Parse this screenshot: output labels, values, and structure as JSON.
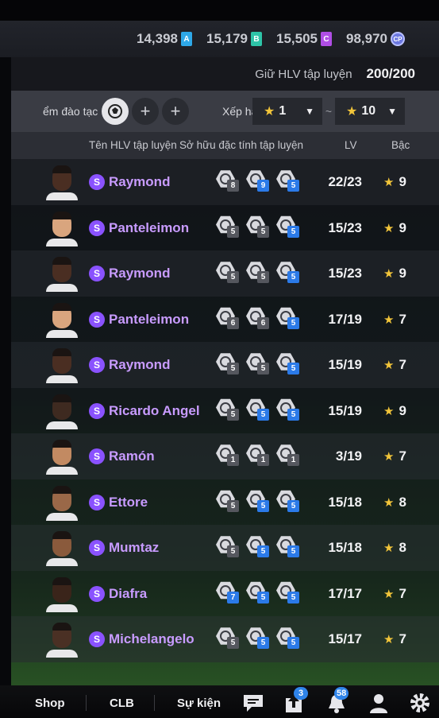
{
  "currencies": [
    {
      "value": "14,398",
      "icon": "A",
      "color": "#2ea8e8"
    },
    {
      "value": "15,179",
      "icon": "B",
      "color": "#2ec4a8"
    },
    {
      "value": "15,505",
      "icon": "C",
      "color": "#b04ee6"
    },
    {
      "value": "98,970",
      "icon": "CP",
      "color": "#6c78e0"
    }
  ],
  "quota": {
    "label": "Giữ HLV tập luyện",
    "value": "200/200"
  },
  "filter": {
    "label": "ểm đào tạc",
    "rank_label": "Xếp hạ",
    "rank_from": "1",
    "rank_to": "10",
    "tilde": "~",
    "plus": "+"
  },
  "columns": {
    "name": "Tên HLV tập luyện",
    "traits": "Sở hữu đặc tính tập luyện",
    "lv": "LV",
    "grade": "Bậc"
  },
  "coaches": [
    {
      "name": "Raymond",
      "traits": [
        {
          "lvl": "8",
          "color": "gray"
        },
        {
          "lvl": "9",
          "color": "blue"
        },
        {
          "lvl": "5",
          "color": "blue"
        }
      ],
      "lv": "22/23",
      "grade": "9",
      "skin": "#4a2e22"
    },
    {
      "name": "Panteleimon",
      "traits": [
        {
          "lvl": "5",
          "color": "gray"
        },
        {
          "lvl": "5",
          "color": "gray"
        },
        {
          "lvl": "5",
          "color": "blue"
        }
      ],
      "lv": "15/23",
      "grade": "9",
      "skin": "#d9a57e"
    },
    {
      "name": "Raymond",
      "traits": [
        {
          "lvl": "5",
          "color": "gray"
        },
        {
          "lvl": "5",
          "color": "gray"
        },
        {
          "lvl": "5",
          "color": "blue"
        }
      ],
      "lv": "15/23",
      "grade": "9",
      "skin": "#4a2e22"
    },
    {
      "name": "Panteleimon",
      "traits": [
        {
          "lvl": "6",
          "color": "gray"
        },
        {
          "lvl": "6",
          "color": "gray"
        },
        {
          "lvl": "5",
          "color": "blue"
        }
      ],
      "lv": "17/19",
      "grade": "7",
      "skin": "#d9a57e"
    },
    {
      "name": "Raymond",
      "traits": [
        {
          "lvl": "5",
          "color": "gray"
        },
        {
          "lvl": "5",
          "color": "gray"
        },
        {
          "lvl": "5",
          "color": "blue"
        }
      ],
      "lv": "15/19",
      "grade": "7",
      "skin": "#4a2e22"
    },
    {
      "name": "Ricardo Angel",
      "traits": [
        {
          "lvl": "5",
          "color": "gray"
        },
        {
          "lvl": "5",
          "color": "blue"
        },
        {
          "lvl": "5",
          "color": "blue"
        }
      ],
      "lv": "15/19",
      "grade": "9",
      "skin": "#3e2a20"
    },
    {
      "name": "Ramón",
      "traits": [
        {
          "lvl": "1",
          "color": "gray"
        },
        {
          "lvl": "1",
          "color": "gray"
        },
        {
          "lvl": "1",
          "color": "gray"
        }
      ],
      "lv": "3/19",
      "grade": "7",
      "skin": "#c28a62"
    },
    {
      "name": "Ettore",
      "traits": [
        {
          "lvl": "5",
          "color": "gray"
        },
        {
          "lvl": "5",
          "color": "blue"
        },
        {
          "lvl": "5",
          "color": "blue"
        }
      ],
      "lv": "15/18",
      "grade": "8",
      "skin": "#9a6848"
    },
    {
      "name": "Mumtaz",
      "traits": [
        {
          "lvl": "5",
          "color": "gray"
        },
        {
          "lvl": "5",
          "color": "blue"
        },
        {
          "lvl": "5",
          "color": "blue"
        }
      ],
      "lv": "15/18",
      "grade": "8",
      "skin": "#8a5a3c"
    },
    {
      "name": "Diafra",
      "traits": [
        {
          "lvl": "7",
          "color": "blue"
        },
        {
          "lvl": "5",
          "color": "blue"
        },
        {
          "lvl": "5",
          "color": "blue"
        }
      ],
      "lv": "17/17",
      "grade": "7",
      "skin": "#3a241a"
    },
    {
      "name": "Michelangelo",
      "traits": [
        {
          "lvl": "5",
          "color": "gray"
        },
        {
          "lvl": "5",
          "color": "blue"
        },
        {
          "lvl": "5",
          "color": "blue"
        }
      ],
      "lv": "15/17",
      "grade": "7",
      "skin": "#4a3024"
    }
  ],
  "nav": {
    "shop": "Shop",
    "clb": "CLB",
    "events": "Sự kiện",
    "chat_icon": "chat-icon",
    "upload_badge": "3",
    "bell_badge": "58"
  }
}
